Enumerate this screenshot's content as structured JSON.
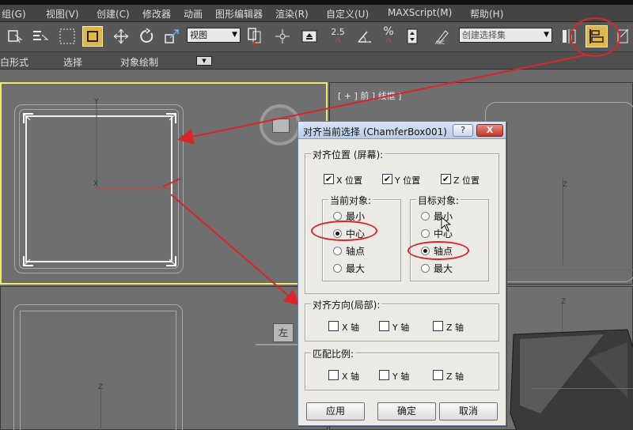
{
  "menubar": {
    "items": [
      "组(G)",
      "视图(V)",
      "创建(C)",
      "修改器",
      "动画",
      "图形编辑器",
      "渲染(R)",
      "自定义(U)",
      "MAXScript(M)",
      "帮助(H)"
    ]
  },
  "toolbar": {
    "view_select": "视图",
    "snap_value": "2.5",
    "percent_label": "%",
    "selection_set_placeholder": "创建选择集"
  },
  "ribbon": {
    "items": [
      "白形式",
      "选择",
      "对象绘制"
    ]
  },
  "viewports": {
    "top_right_label": "[ + ] 前 ] 线框 ]",
    "bottom_left_label": "左",
    "axis_y": "Y",
    "axis_x": "X",
    "axis_z": "Z"
  },
  "dialog": {
    "title": "对齐当前选择 (ChamferBox001)",
    "help_label": "?",
    "close_label": "X",
    "align_position": {
      "title": "对齐位置 (屏幕):",
      "checkboxes": [
        {
          "label": "X 位置",
          "checked": true
        },
        {
          "label": "Y 位置",
          "checked": true
        },
        {
          "label": "Z 位置",
          "checked": true
        }
      ],
      "current_object": {
        "title": "当前对象:",
        "options": [
          "最小",
          "中心",
          "轴点",
          "最大"
        ],
        "selected": "中心"
      },
      "target_object": {
        "title": "目标对象:",
        "options": [
          "最小",
          "中心",
          "轴点",
          "最大"
        ],
        "selected": "轴点"
      }
    },
    "align_orientation": {
      "title": "对齐方向(局部):",
      "checkboxes": [
        {
          "label": "X 轴",
          "checked": false
        },
        {
          "label": "Y 轴",
          "checked": false
        },
        {
          "label": "Z 轴",
          "checked": false
        }
      ]
    },
    "match_scale": {
      "title": "匹配比例:",
      "checkboxes": [
        {
          "label": "X 轴",
          "checked": false
        },
        {
          "label": "Y 轴",
          "checked": false
        },
        {
          "label": "Z 轴",
          "checked": false
        }
      ]
    },
    "buttons": {
      "apply": "应用",
      "ok": "确定",
      "cancel": "取消"
    }
  },
  "colors": {
    "annotation_red": "#d8262a",
    "active_viewport_border": "#f0e96a",
    "active_tool": "#e0b54a"
  }
}
